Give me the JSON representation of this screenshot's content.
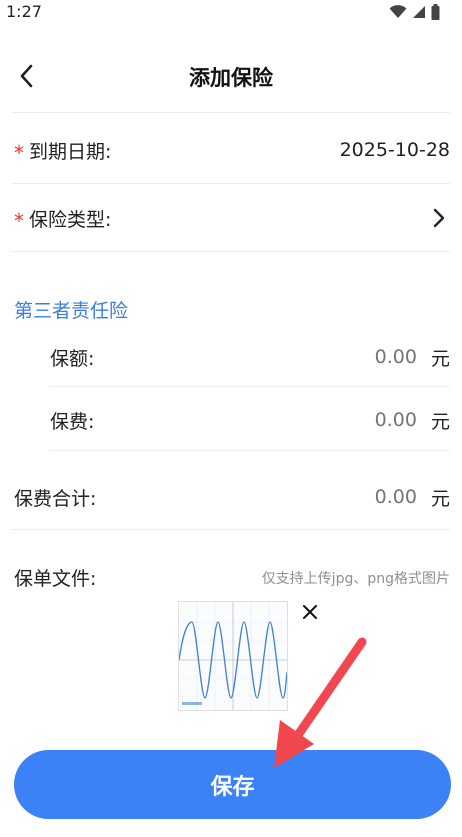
{
  "status_bar": {
    "time": "1:27"
  },
  "header": {
    "title": "添加保险"
  },
  "form": {
    "expiry": {
      "label": "到期日期:",
      "value": "2025-10-28",
      "required_mark": "*"
    },
    "insurance_type": {
      "label": "保险类型:",
      "required_mark": "*"
    },
    "third_party": {
      "section_title": "第三者责任险",
      "coverage": {
        "label": "保额:",
        "value": "0.00",
        "unit": "元"
      },
      "premium": {
        "label": "保费:",
        "value": "0.00",
        "unit": "元"
      }
    },
    "premium_total": {
      "label": "保费合计:",
      "value": "0.00",
      "unit": "元"
    },
    "policy_file": {
      "label": "保单文件:",
      "hint": "仅支持上传jpg、png格式图片"
    }
  },
  "save_label": "保存",
  "colors": {
    "accent": "#3b82f6",
    "section_title": "#3b7de8",
    "required": "#e53935",
    "annotation_arrow": "#f2474f"
  },
  "icons": [
    "wifi-icon",
    "signal-icon",
    "battery-icon",
    "back-arrow-icon",
    "chevron-right-icon",
    "close-icon"
  ]
}
